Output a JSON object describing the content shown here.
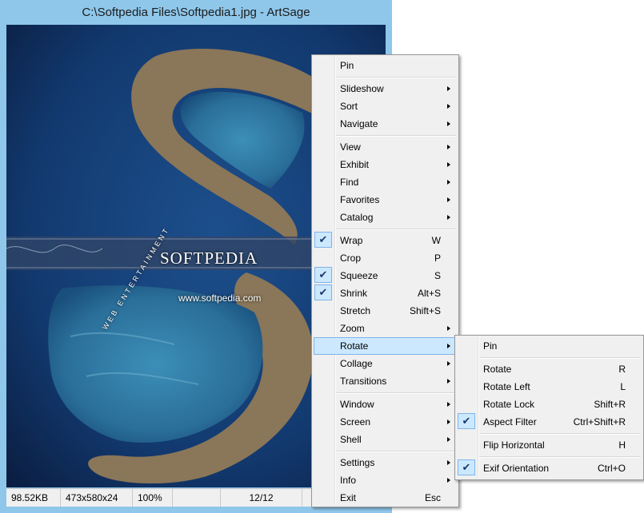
{
  "window": {
    "title": "C:\\Softpedia Files\\Softpedia1.jpg - ArtSage"
  },
  "image": {
    "brand_text": "SOFTPEDIA",
    "url_text": "www.softpedia.com",
    "tagline_text": "WEB ENTERTAINMENT"
  },
  "statusbar": {
    "file_size": "98.52KB",
    "dimensions": "473x580x24",
    "zoom": "100%",
    "blank": "",
    "position": "12/12"
  },
  "context_menu": {
    "items": [
      {
        "label": "Pin"
      },
      {
        "label": "Slideshow"
      },
      {
        "label": "Sort"
      },
      {
        "label": "Navigate"
      },
      {
        "label": "View"
      },
      {
        "label": "Exhibit"
      },
      {
        "label": "Find"
      },
      {
        "label": "Favorites"
      },
      {
        "label": "Catalog"
      },
      {
        "label": "Wrap",
        "shortcut": "W"
      },
      {
        "label": "Crop",
        "shortcut": "P"
      },
      {
        "label": "Squeeze",
        "shortcut": "S"
      },
      {
        "label": "Shrink",
        "shortcut": "Alt+S"
      },
      {
        "label": "Stretch",
        "shortcut": "Shift+S"
      },
      {
        "label": "Zoom"
      },
      {
        "label": "Rotate"
      },
      {
        "label": "Collage"
      },
      {
        "label": "Transitions"
      },
      {
        "label": "Window"
      },
      {
        "label": "Screen"
      },
      {
        "label": "Shell"
      },
      {
        "label": "Settings"
      },
      {
        "label": "Info"
      },
      {
        "label": "Exit",
        "shortcut": "Esc"
      }
    ]
  },
  "rotate_submenu": {
    "items": [
      {
        "label": "Pin"
      },
      {
        "label": "Rotate",
        "shortcut": "R"
      },
      {
        "label": "Rotate Left",
        "shortcut": "L"
      },
      {
        "label": "Rotate Lock",
        "shortcut": "Shift+R"
      },
      {
        "label": "Aspect Filter",
        "shortcut": "Ctrl+Shift+R"
      },
      {
        "label": "Flip Horizontal",
        "shortcut": "H"
      },
      {
        "label": "Exif Orientation",
        "shortcut": "Ctrl+O"
      }
    ]
  },
  "colors": {
    "frame": "#8fc7ea",
    "menu_bg": "#f0f0f0",
    "highlight": "#cce8ff",
    "highlight_border": "#7eb4ea"
  }
}
